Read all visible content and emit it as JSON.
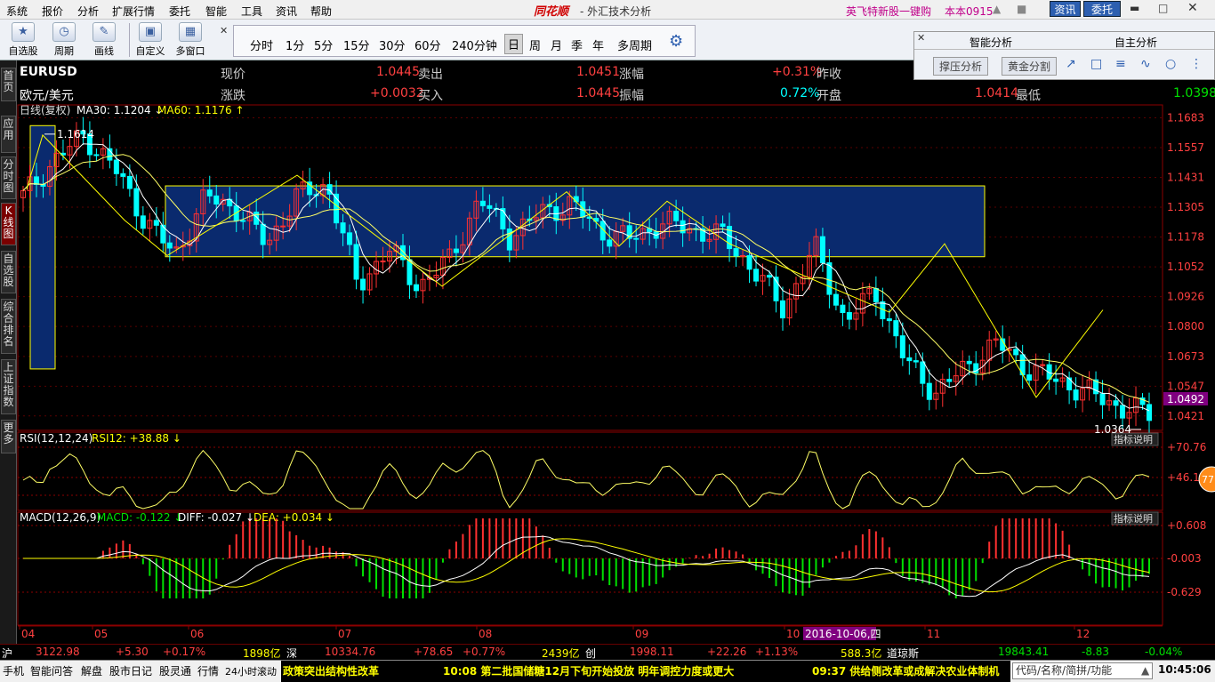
{
  "menu": [
    "系统",
    "报价",
    "分析",
    "扩展行情",
    "委托",
    "智能",
    "工具",
    "资讯",
    "帮助"
  ],
  "app_logo": "同花顺",
  "window_title": "- 外汇技术分析",
  "top_right": {
    "ad_text": "英飞特新股一键购",
    "version": "本本0915",
    "btn_info": "资讯",
    "btn_trade": "委托"
  },
  "toolbar": {
    "buttons": [
      {
        "label": "自选股",
        "icon": "star-icon"
      },
      {
        "label": "周期",
        "icon": "clock-icon"
      },
      {
        "label": "画线",
        "icon": "pencil-icon"
      },
      {
        "label": "自定义",
        "icon": "custom-icon"
      },
      {
        "label": "多窗口",
        "icon": "windows-icon"
      }
    ],
    "periods": [
      "分时",
      "1分",
      "5分",
      "15分",
      "30分",
      "60分",
      "240分钟",
      "日",
      "周",
      "月",
      "季",
      "年",
      "多周期"
    ],
    "active_period": "日"
  },
  "smart_panel": {
    "tab1": "智能分析",
    "tab2": "自主分析",
    "btn1": "撑压分析",
    "btn2": "黄金分割"
  },
  "sidebar": [
    "首页",
    "应用",
    "分时图",
    "K线图",
    "自选股",
    "综合排名",
    "上证指数",
    "更多"
  ],
  "quote": {
    "symbol": "EURUSD",
    "name": "欧元/美元",
    "l_current": "现价",
    "current": "1.0445",
    "l_sell": "卖出",
    "sell": "1.0451",
    "l_change_pct": "涨幅",
    "change_pct": "+0.31%",
    "l_prev_close": "昨收",
    "l_change": "涨跌",
    "change": "+0.0032",
    "l_buy": "买入",
    "buy": "1.0445",
    "l_amplitude": "振幅",
    "amplitude": "0.72%",
    "l_open": "开盘",
    "open": "1.0414",
    "l_low": "最低",
    "low": "1.0398"
  },
  "chart_data": [
    {
      "type": "candlestick",
      "title": "日线(复权)",
      "ma_labels": {
        "ma30": "MA30: 1.1204",
        "ma60": "MA60: 1.1176"
      },
      "y_ticks": [
        "1.1683",
        "1.1557",
        "1.1431",
        "1.1305",
        "1.1178",
        "1.1052",
        "1.0926",
        "1.0800",
        "1.0673",
        "1.0547",
        "1.0421"
      ],
      "ylim": [
        1.036,
        1.17
      ],
      "current_price_label": "1.0492",
      "high_marker": "1.1614",
      "low_marker": "1.0364",
      "x_ticks": [
        "04",
        "05",
        "06",
        "07",
        "08",
        "09",
        "10",
        "11",
        "12"
      ],
      "date_tag": "2016-10-06,四",
      "key_closes": [
        1.135,
        1.15,
        1.161,
        1.147,
        1.125,
        1.11,
        1.135,
        1.13,
        1.115,
        1.135,
        1.14,
        1.097,
        1.113,
        1.097,
        1.108,
        1.134,
        1.118,
        1.128,
        1.132,
        1.12,
        1.117,
        1.124,
        1.121,
        1.118,
        1.104,
        1.087,
        1.114,
        1.082,
        1.095,
        1.065,
        1.052,
        1.063,
        1.073,
        1.062,
        1.057,
        1.052,
        1.046,
        1.043
      ]
    },
    {
      "type": "line",
      "title": "RSI(12,12,24)",
      "value_label": "RSI12: +38.88",
      "y_ticks": [
        "+70.76",
        "+46.11"
      ],
      "button": "指标说明",
      "bubble": "77"
    },
    {
      "type": "bar",
      "title": "MACD(12,26,9)",
      "macd": "MACD: -0.122",
      "diff": "DIFF: -0.027",
      "dea": "DEA: +0.034",
      "y_ticks": [
        "+0.608",
        "-0.003",
        "-0.629"
      ],
      "button": "指标说明"
    }
  ],
  "status": [
    {
      "name": "沪",
      "price": "3122.98",
      "chg": "+5.30",
      "pct": "+0.17%",
      "vol": "1898亿"
    },
    {
      "name": "深",
      "price": "10334.76",
      "chg": "+78.65",
      "pct": "+0.77%",
      "vol": "2439亿"
    },
    {
      "name": "创",
      "price": "1998.11",
      "chg": "+22.26",
      "pct": "+1.13%",
      "vol": "588.3亿"
    },
    {
      "name": "道琼斯",
      "price": "19843.41",
      "chg": "-8.83",
      "pct": "-0.04%"
    }
  ],
  "bottom": {
    "tabs": [
      "手机",
      "智能问答",
      "解盘",
      "股市日记",
      "股灵通",
      "行情",
      "24小时滚动"
    ],
    "news1": "政策突出结构性改革",
    "news2": "10:08 第二批国储糖12月下旬开始投放 明年调控力度或更大",
    "news3": "09:37 供给侧改革或成解决农业体制机",
    "search_placeholder": "代码/名称/简拼/功能",
    "clock": "10:45:06"
  }
}
